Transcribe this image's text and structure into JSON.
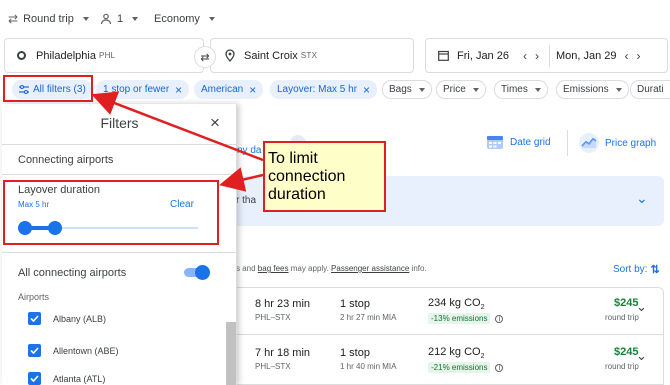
{
  "trip": {
    "type_label": "Round trip",
    "passengers": "1",
    "cabin": "Economy"
  },
  "search": {
    "origin_city": "Philadelphia",
    "origin_code": "PHL",
    "dest_city": "Saint Croix",
    "dest_code": "STX",
    "depart_date": "Fri, Jan 26",
    "return_date": "Mon, Jan 29"
  },
  "filter_chips": [
    {
      "label": "All filters (3)"
    },
    {
      "label": "1 stop or fewer"
    },
    {
      "label": "American"
    },
    {
      "label": "Layover: Max 5 hr"
    },
    {
      "label": "Bags"
    },
    {
      "label": "Price"
    },
    {
      "label": "Times"
    },
    {
      "label": "Emissions"
    },
    {
      "label": "Durati"
    }
  ],
  "results": {
    "date_grid_label": "Date grid",
    "price_graph_label": "Price graph",
    "partial_text_1": "ny da",
    "partial_text_2": "r tha",
    "fees_prefix": "s and ",
    "bag_fees_link": "bag fees",
    "fees_middle": " may apply. ",
    "assistance_link": "Passenger assistance",
    "fees_suffix": " info.",
    "sort_label": "Sort by:",
    "flights": [
      {
        "duration": "8 hr 23 min",
        "route": "PHL–STX",
        "stops": "1 stop",
        "layover": "2 hr 27 min MIA",
        "co2": "234 kg CO",
        "co2_sub": "2",
        "emissions": "-13% emissions",
        "price": "$245",
        "price_note": "round trip"
      },
      {
        "duration": "7 hr 18 min",
        "route": "PHL–STX",
        "stops": "1 stop",
        "layover": "1 hr 40 min MIA",
        "co2": "212 kg CO",
        "co2_sub": "2",
        "emissions": "-21% emissions",
        "price": "$245",
        "price_note": "round trip"
      }
    ]
  },
  "filters_panel": {
    "title": "Filters",
    "section": "Connecting airports",
    "layover_title": "Layover duration",
    "layover_value": "Max 5 hr",
    "clear_label": "Clear",
    "layover_level": 0.18,
    "all_airports_label": "All connecting airports",
    "airports_heading": "Airports",
    "airports": [
      {
        "label": "Albany (ALB)"
      },
      {
        "label": "Allentown (ABE)"
      },
      {
        "label": "Atlanta (ATL)"
      }
    ]
  },
  "annotation": {
    "text": "To limit connection duration"
  },
  "colors": {
    "accent": "#1a73e8",
    "annotation_red": "#e02020",
    "callout_bg": "#fefec8",
    "price_green": "#188038"
  }
}
